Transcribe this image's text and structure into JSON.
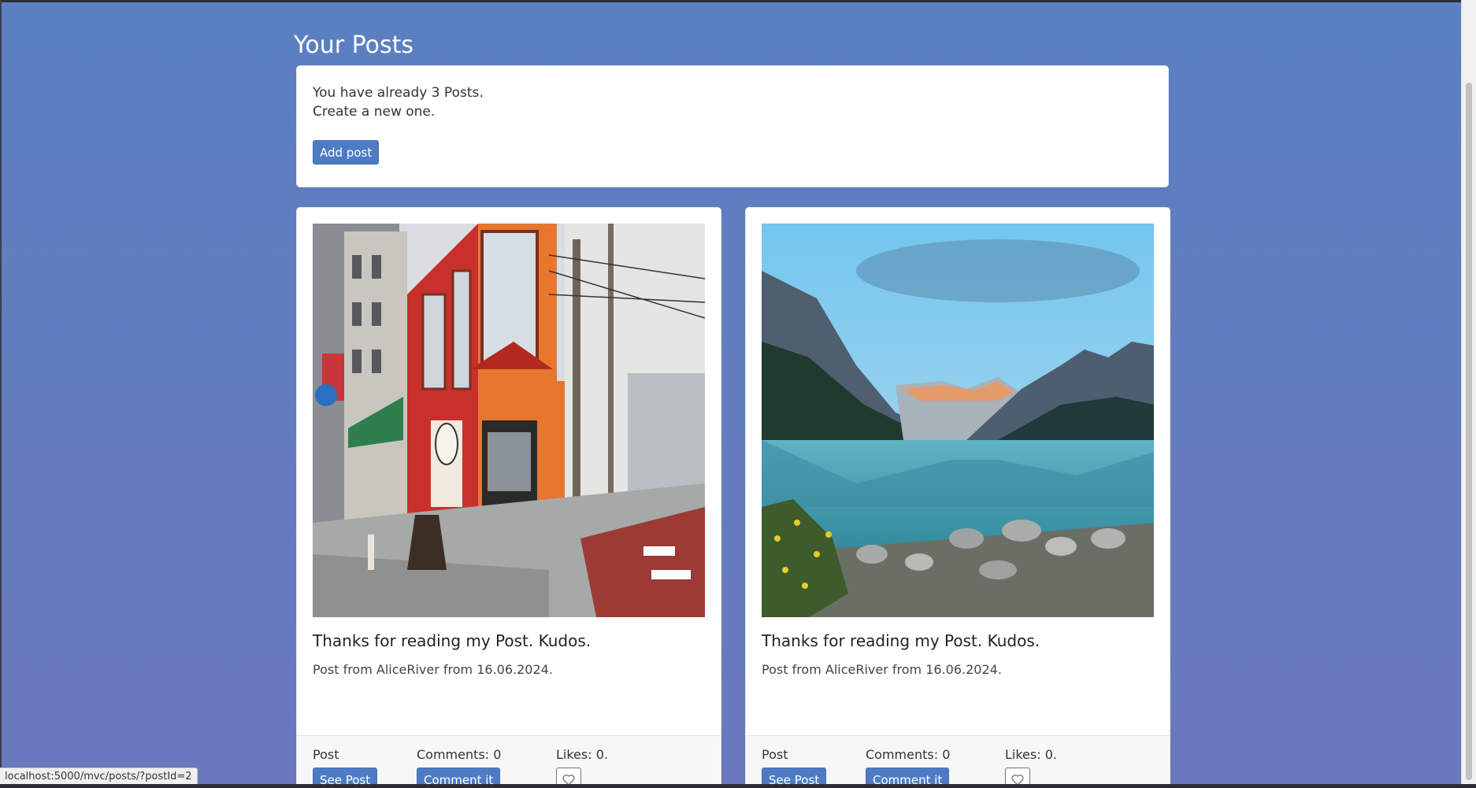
{
  "page": {
    "title": "Your Posts"
  },
  "summary": {
    "line1": "You have already 3 Posts.",
    "line2": "Create a new one.",
    "add_button": "Add post"
  },
  "posts": [
    {
      "image": "street-shop-photo",
      "title": "Thanks for reading my Post. Kudos.",
      "meta": "Post from AliceRiver from 16.06.2024.",
      "post_label": "Post",
      "see_button": "See Post",
      "comments_label": "Comments: 0",
      "comment_button": "Comment it",
      "likes_label": "Likes: 0.",
      "like_icon": "heart-icon"
    },
    {
      "image": "mountain-lake-photo",
      "title": "Thanks for reading my Post. Kudos.",
      "meta": "Post from AliceRiver from 16.06.2024.",
      "post_label": "Post",
      "see_button": "See Post",
      "comments_label": "Comments: 0",
      "comment_button": "Comment it",
      "likes_label": "Likes: 0.",
      "like_icon": "heart-icon"
    }
  ],
  "status_bar": {
    "url": "localhost:5000/mvc/posts/?postId=2"
  },
  "colors": {
    "background_top": "#5a80c2",
    "background_bottom": "#6b78bd",
    "button": "#4e7cc4"
  }
}
